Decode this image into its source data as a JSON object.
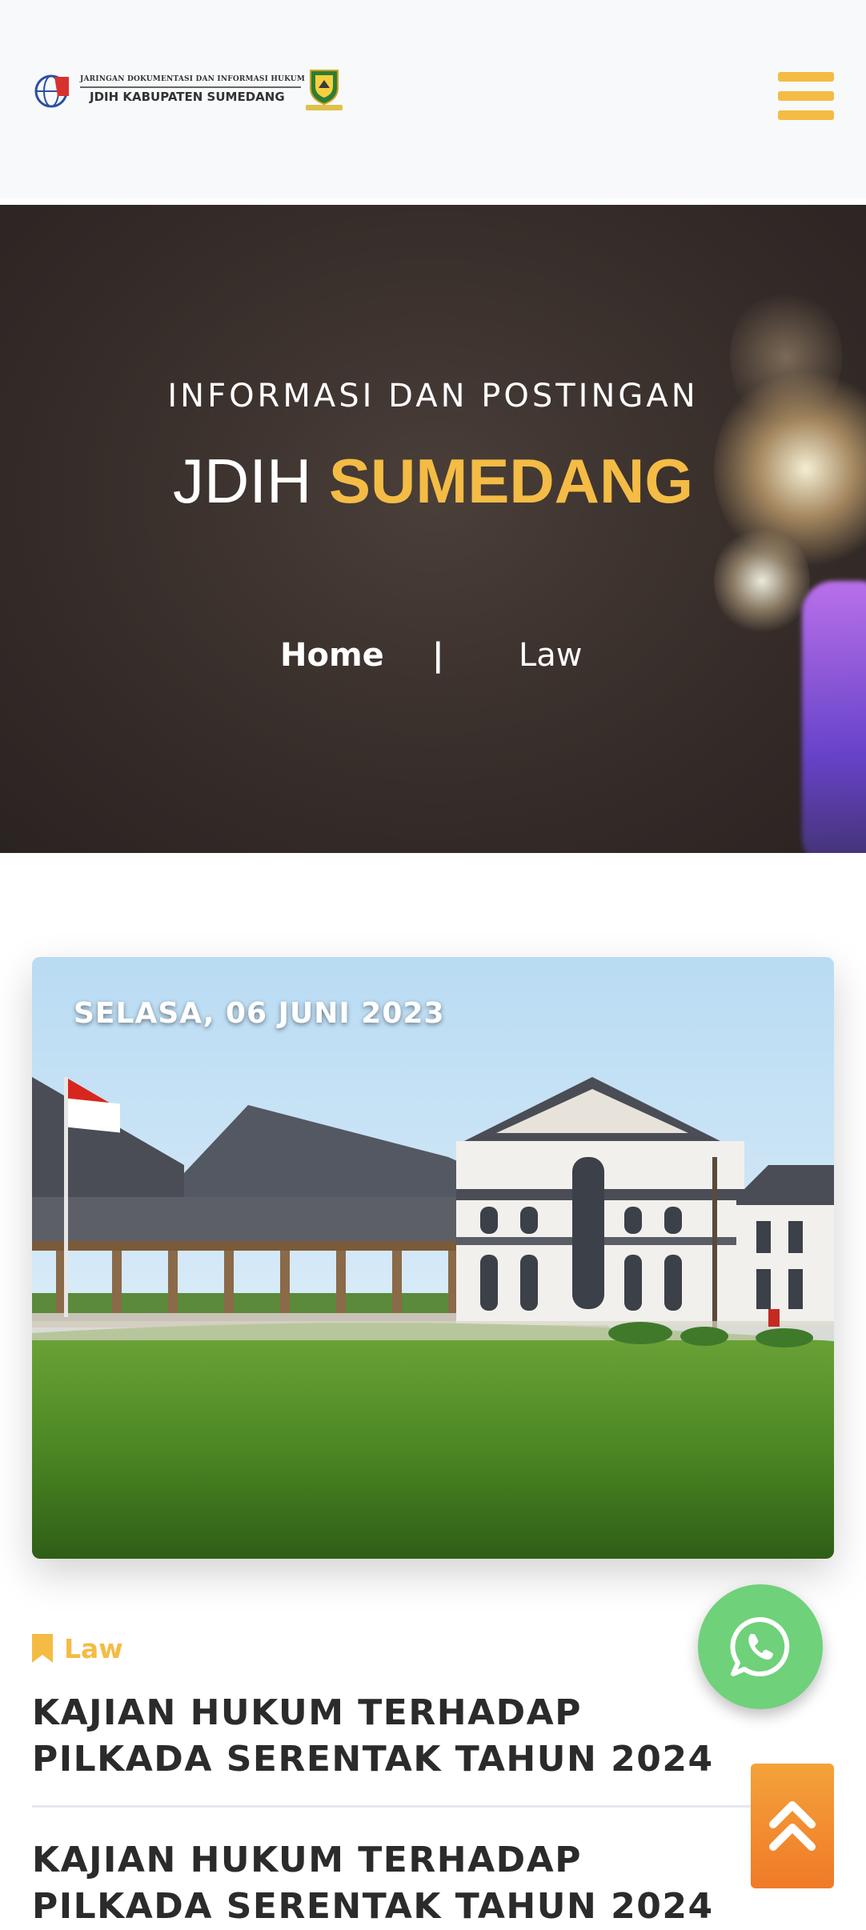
{
  "header": {
    "logo_tagline": "JARINGAN DOKUMENTASI DAN INFORMASI HUKUM",
    "logo_org": "JDIH KABUPATEN SUMEDANG",
    "menu_icon": "hamburger-menu-icon",
    "accent_color": "#f4bc45"
  },
  "hero": {
    "subtitle": "INFORMASI DAN POSTINGAN",
    "title_plain": "JDIH",
    "title_accent": "SUMEDANG",
    "breadcrumb": {
      "home": "Home",
      "separator": "|",
      "current": "Law"
    }
  },
  "post": {
    "date": "SELASA, 06 JUNI 2023",
    "category": "Law",
    "category_icon": "bookmark-icon",
    "title": "KAJIAN HUKUM TERHADAP PILKADA SERENTAK TAHUN 2024",
    "title_repeat": "KAJIAN HUKUM TERHADAP PILKADA SERENTAK TAHUN 2024"
  },
  "floating": {
    "whatsapp_icon": "whatsapp-icon",
    "whatsapp_color": "#6fd17a",
    "scroll_top_icon": "double-chevron-up-icon",
    "scroll_top_color": "#f07a28"
  }
}
